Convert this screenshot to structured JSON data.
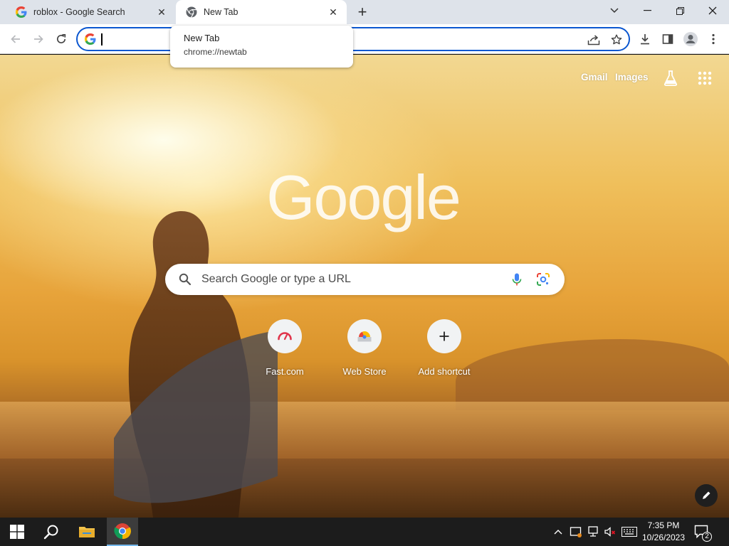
{
  "tabs": [
    {
      "title": "roblox - Google Search",
      "icon": "google-g-icon",
      "active": false
    },
    {
      "title": "New Tab",
      "icon": "chrome-icon",
      "active": true
    }
  ],
  "tab_controls": {
    "new_tab": "+",
    "search_tabs": "tab-search-icon"
  },
  "window_controls": [
    "minimize-icon",
    "restore-icon",
    "close-icon"
  ],
  "toolbar": {
    "address_value": "",
    "omnibox_icons": [
      "share-icon",
      "bookmark-star-icon"
    ],
    "right_icons": [
      "download-icon",
      "side-panel-icon",
      "profile-icon",
      "menu-kebab-icon"
    ]
  },
  "tooltip": {
    "title": "New Tab",
    "url": "chrome://newtab"
  },
  "ntp": {
    "top_links": {
      "gmail": "Gmail",
      "images": "Images"
    },
    "logo": "Google",
    "search_placeholder": "Search Google or type a URL",
    "shortcuts": [
      {
        "label": "Fast.com",
        "icon": "fast-com-icon"
      },
      {
        "label": "Web Store",
        "icon": "web-store-icon"
      },
      {
        "label": "Add shortcut",
        "icon": "plus-icon"
      }
    ]
  },
  "taskbar": {
    "time": "7:35 PM",
    "date": "10/26/2023",
    "notifications": "2"
  },
  "colors": {
    "accent": "#0b57d0",
    "tab_strip": "#dee3ea",
    "taskbar": "#1c1c1c"
  }
}
